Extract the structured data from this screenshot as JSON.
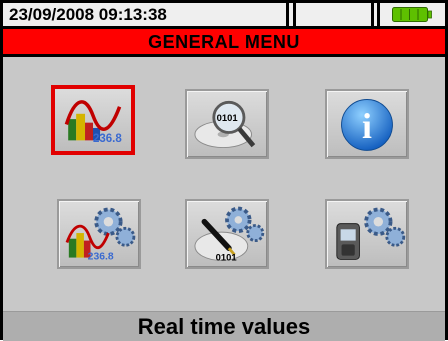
{
  "status_bar": {
    "datetime": "23/09/2008 09:13:38",
    "battery_icon": "battery-full-icon",
    "battery_color": "#5ec000"
  },
  "title_bar": {
    "title": "GENERAL MENU",
    "background": "#ff0000"
  },
  "menu": {
    "selected_index": 0,
    "items": [
      {
        "icon": "real-time-values-icon",
        "icon_text": "236.8"
      },
      {
        "icon": "memory-disk-search-icon",
        "icon_text": "0101"
      },
      {
        "icon": "info-icon",
        "icon_text": "i"
      },
      {
        "icon": "analyzer-settings-gears-icon",
        "icon_text": "236.8"
      },
      {
        "icon": "recording-settings-disk-pen-gears-icon",
        "icon_text": "0101"
      },
      {
        "icon": "instrument-settings-gears-icon",
        "icon_text": ""
      }
    ]
  },
  "footer": {
    "label": "Real time values"
  }
}
